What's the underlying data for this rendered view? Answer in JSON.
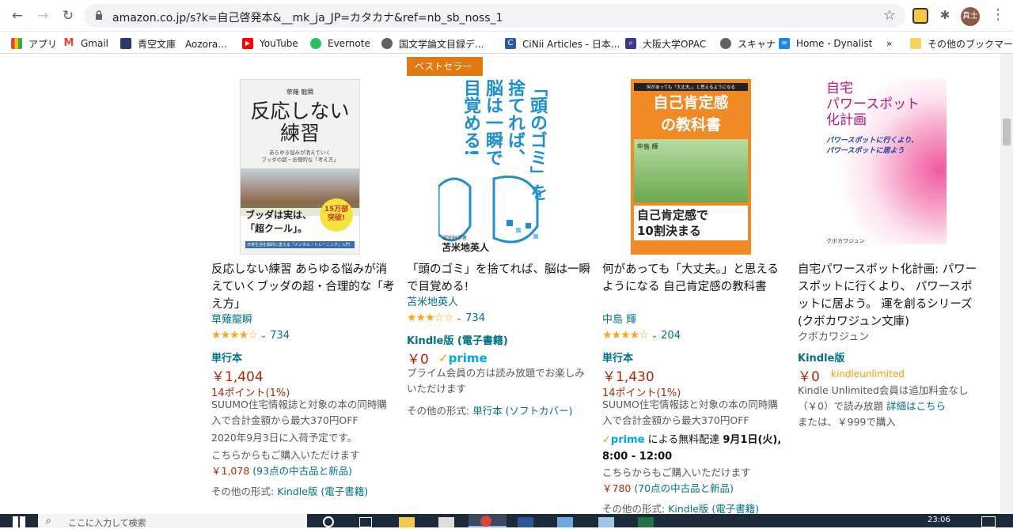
{
  "browser": {
    "url": "amazon.co.jp/s?k=自己啓発本&__mk_ja_JP=カタカナ&ref=nb_sb_noss_1",
    "profile_label": "真士",
    "bookmarks": [
      "アプリ",
      "Gmail",
      "青空文庫　Aozora...",
      "YouTube",
      "Evernote",
      "国文学論文目録デ...",
      "CiNii Articles - 日本...",
      "大阪大学OPAC",
      "スキャナ",
      "Home - Dynalist",
      "»",
      "その他のブックマーク"
    ]
  },
  "products": [
    {
      "cover": {
        "top": "草薙 龍瞬",
        "main": "反応しない\n練習",
        "sub": "あらゆる悩みが消えていく\nブッダの超・合理的な「考え方」",
        "bottom": "ブッダは実は、\n「超クール」。",
        "badge": "15万部\n突破!",
        "footer": "日常生活を劇的に変える「メンタル・トレーニング」入門"
      },
      "title": "反応しない練習 あらゆる悩みが消えていくブッダの超・合理的な「考え方」",
      "author": "草薙龍瞬",
      "rating_count": "734",
      "format": "単行本",
      "price": "￥1,404",
      "points": "14ポイント(1%)",
      "note": "SUUMO住宅情報誌と対象の本の同時購入で合計金額から最大370円OFF",
      "availability": "2020年9月3日に入荷予定です。",
      "other_buy": "こちらからもご購入いただけます",
      "used_price": "￥1,078",
      "used_link": "(93点の中古品と新品)",
      "other_formats_label": "その他の形式:",
      "other_formats_link": "Kindle版 (電子書籍)"
    },
    {
      "badge": "ベストセラー",
      "cover": {
        "main": "「頭のゴミ」を\n捨てれば、\n脳は一瞬で\n目覚める!",
        "author": "苫米地英人",
        "role": "認知科学者"
      },
      "title": "「頭のゴミ」を捨てれば、脳は一瞬で目覚める!",
      "author": "苫米地英人",
      "rating_count": "734",
      "format": "Kindle版 (電子書籍)",
      "price": "￥0",
      "prime": "prime",
      "note": "プライム会員の方は読み放題でお楽しみいただけます",
      "other_formats_label": "その他の形式:",
      "other_formats_link": "単行本 (ソフトカバー)"
    },
    {
      "cover": {
        "top": "何があっても「大丈夫。」と思えるようになる",
        "main": "自己肯定感\nの教科書",
        "author": "中島 輝",
        "bottom": "自己肯定感で\n10割決まる"
      },
      "title": "何があっても「大丈夫。」と思えるようになる 自己肯定感の教科書",
      "author": "中島 輝",
      "rating_count": "204",
      "format": "単行本",
      "price": "￥1,430",
      "points": "14ポイント(1%)",
      "note": "SUUMO住宅情報誌と対象の本の同時購入で合計金額から最大370円OFF",
      "prime": "prime",
      "delivery_text": "による無料配達",
      "delivery_date": "9月1日(火), 8:00 - 12:00",
      "other_buy": "こちらからもご購入いただけます",
      "used_price": "￥780",
      "used_link": "(70点の中古品と新品)",
      "other_formats_label": "その他の形式:",
      "other_formats_link": "Kindle版 (電子書籍)"
    },
    {
      "cover": {
        "main": "自宅\nパワースポット\n化計画",
        "sub": "パワースポットに行くより、\nパワースポットに居よう",
        "author": "クボカワジュン"
      },
      "title": "自宅パワースポット化計画: パワースポットに行くより、 パワースポットに居よう。 運を創るシリーズ (クボカワジュン文庫)",
      "author": "クボカワジュン",
      "format": "Kindle版",
      "price": "￥0",
      "ku_logo": "kindleunlimited",
      "note_a": "Kindle Unlimited会員は追加料金なし（￥0）で読み放題",
      "note_link": "詳細はこちら",
      "alt_buy": "または、￥999で購入"
    }
  ],
  "taskbar": {
    "search_placeholder": "ここに入力して検索",
    "time": "23:06"
  }
}
